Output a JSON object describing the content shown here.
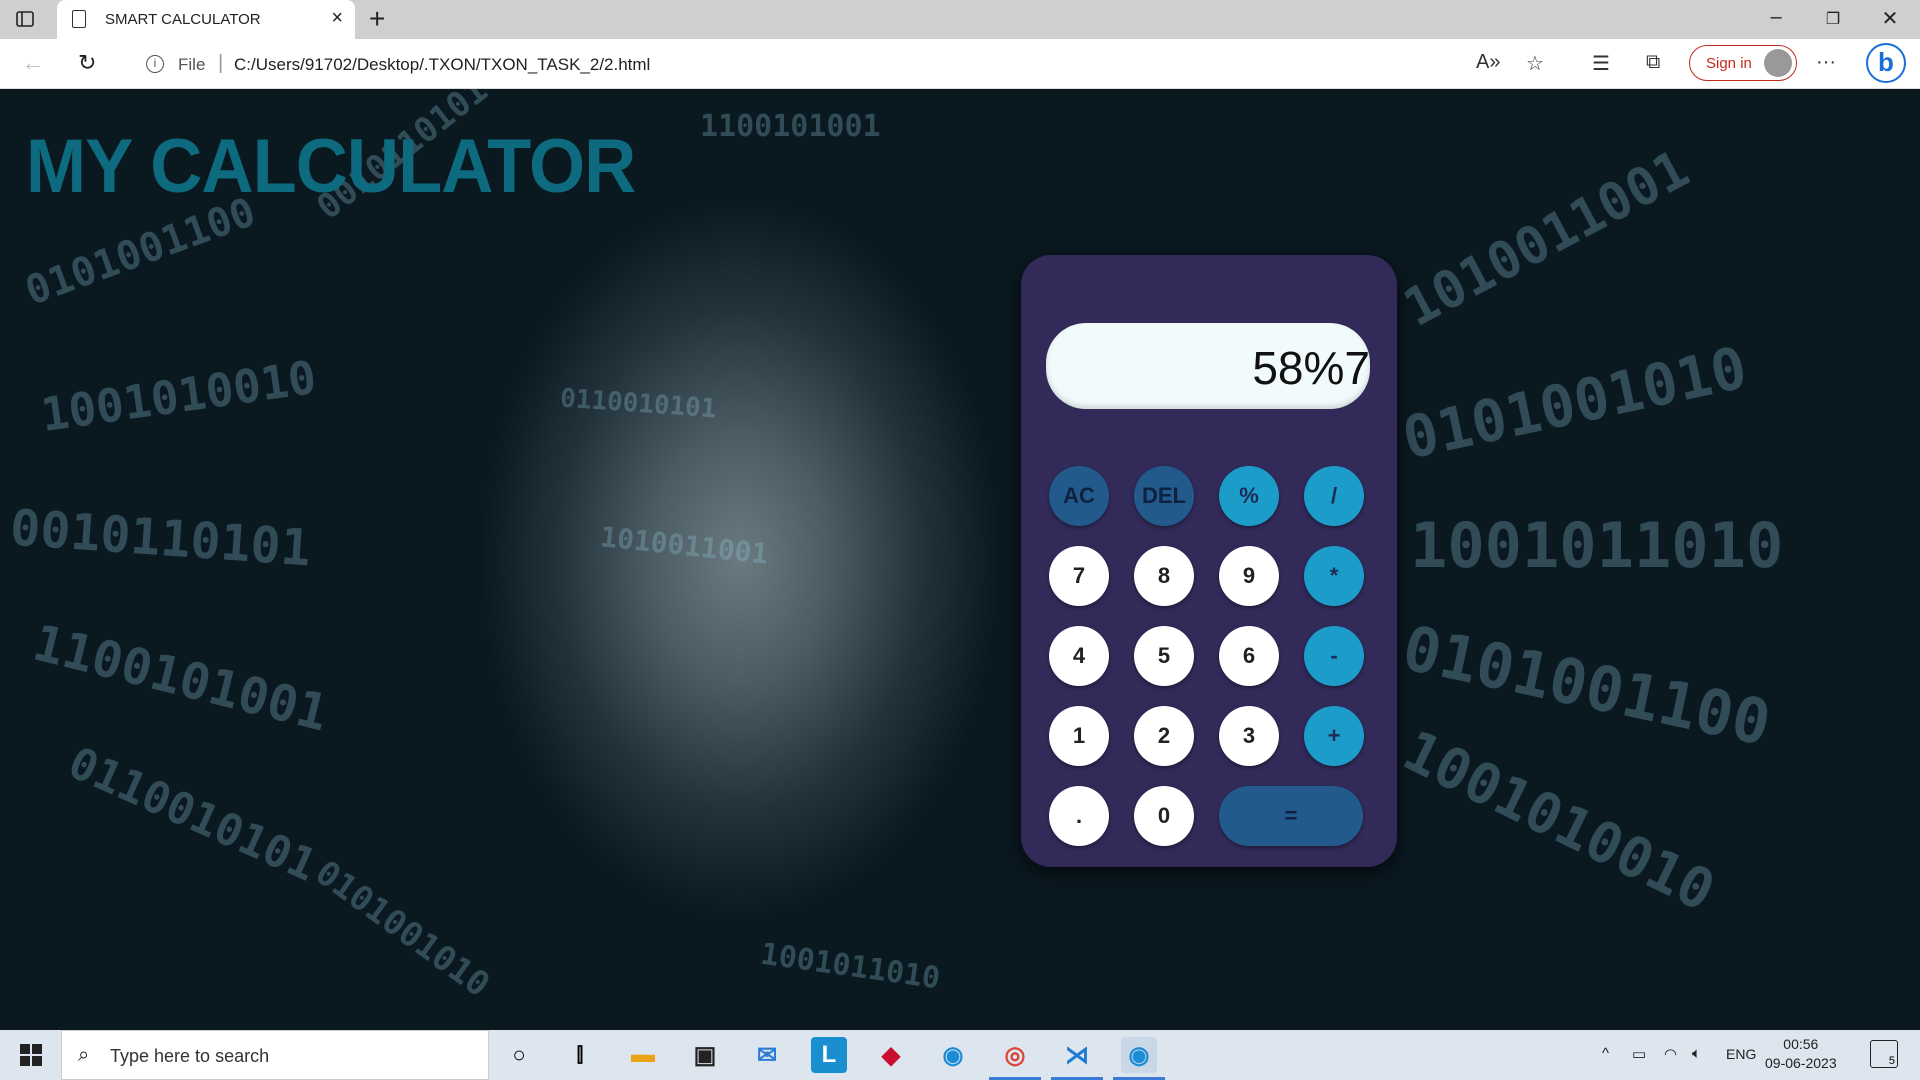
{
  "browser": {
    "tab_title": "SMART CALCULATOR",
    "address_file_label": "File",
    "address_url": "C:/Users/91702/Desktop/.TXON/TXON_TASK_2/2.html",
    "sign_in_label": "Sign in"
  },
  "page": {
    "title": "MY CALCULATOR",
    "background_binary": [
      "0101001100",
      "1001010010",
      "0010110101",
      "1100101001",
      "0110010101",
      "1010011001",
      "0101001010",
      "1001011010"
    ]
  },
  "calculator": {
    "display_value": "58%7",
    "keys": {
      "ac": "AC",
      "del": "DEL",
      "percent": "%",
      "divide": "/",
      "seven": "7",
      "eight": "8",
      "nine": "9",
      "multiply": "*",
      "four": "4",
      "five": "5",
      "six": "6",
      "minus": "-",
      "one": "1",
      "two": "2",
      "three": "3",
      "plus": "+",
      "dot": ".",
      "zero": "0",
      "equals": "="
    },
    "colors": {
      "body": "#322b5a",
      "number_key": "#ffffff",
      "function_key": "#225a8c",
      "operator_key": "#1b9cc9",
      "title": "#0e6a7e"
    }
  },
  "taskbar": {
    "search_placeholder": "Type here to search",
    "language": "ENG",
    "time": "00:56",
    "date": "09-06-2023",
    "notification_count": "5"
  }
}
